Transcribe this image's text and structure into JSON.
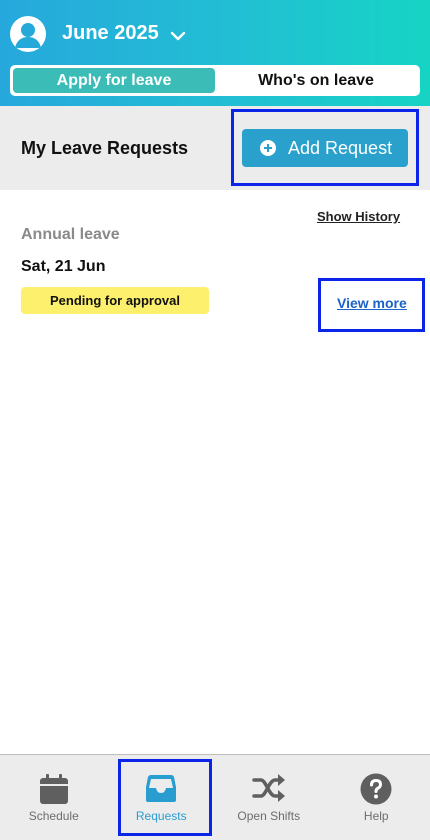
{
  "header": {
    "month_title": "June 2025",
    "tabs": [
      {
        "label": "Apply for leave",
        "active": true
      },
      {
        "label": "Who's on leave",
        "active": false
      }
    ],
    "accent_color": "#3cbcb6"
  },
  "subbar": {
    "title": "My Leave Requests",
    "add_button_label": "Add Request"
  },
  "requests": {
    "show_history_label": "Show History",
    "items": [
      {
        "type": "Annual leave",
        "date": "Sat, 21 Jun",
        "status": "Pending for approval",
        "view_more_label": "View more"
      }
    ]
  },
  "nav": {
    "items": [
      {
        "label": "Schedule",
        "icon": "calendar-icon",
        "active": false
      },
      {
        "label": "Requests",
        "icon": "inbox-icon",
        "active": true
      },
      {
        "label": "Open Shifts",
        "icon": "shuffle-icon",
        "active": false
      },
      {
        "label": "Help",
        "icon": "help-icon",
        "active": false
      }
    ],
    "active_color": "#2a9dd0"
  }
}
